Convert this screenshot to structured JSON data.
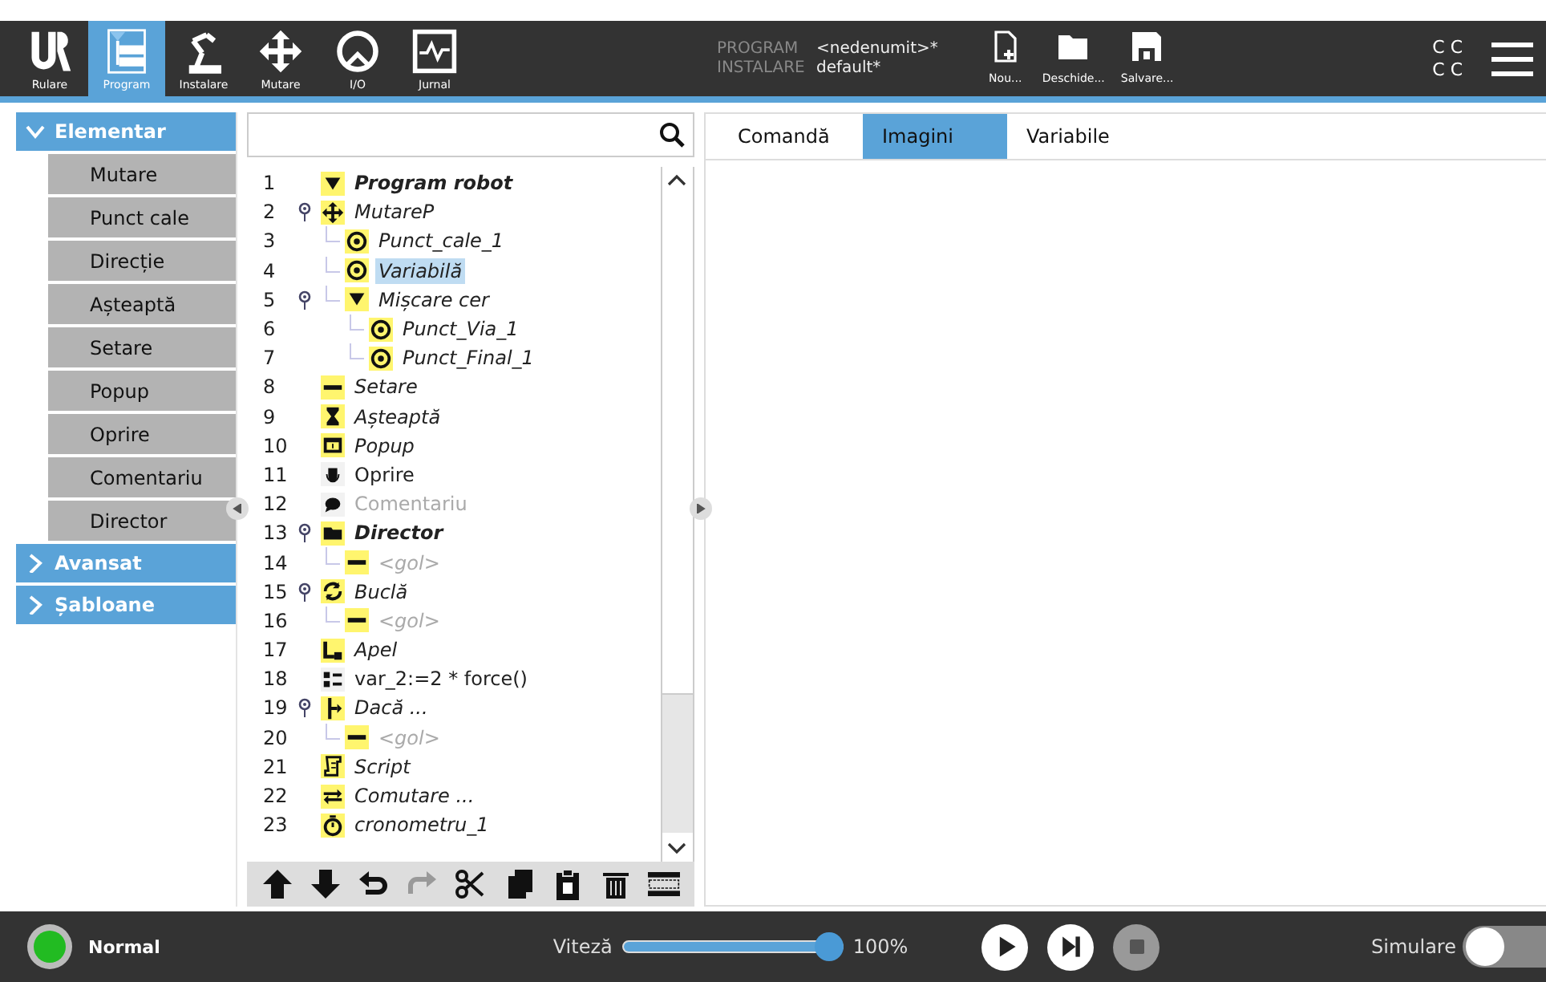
{
  "nav_tabs": [
    {
      "label": "Rulare",
      "kind": "logo",
      "selected": false
    },
    {
      "label": "Program",
      "kind": "program",
      "selected": true
    },
    {
      "label": "Instalare",
      "kind": "robot",
      "selected": false
    },
    {
      "label": "Mutare",
      "kind": "move",
      "selected": false
    },
    {
      "label": "I/O",
      "kind": "io",
      "selected": false
    },
    {
      "label": "Jurnal",
      "kind": "log",
      "selected": false
    }
  ],
  "file_info": [
    {
      "label": "PROGRAM",
      "value": "<nedenumit>*"
    },
    {
      "label": "INSTALARE",
      "value": "default*"
    }
  ],
  "file_buttons": [
    {
      "label": "Nou...",
      "kind": "new"
    },
    {
      "label": "Deschide...",
      "kind": "open"
    },
    {
      "label": "Salvare...",
      "kind": "save"
    }
  ],
  "indicator": [
    "C C",
    "C C"
  ],
  "sidebar": {
    "sections": [
      {
        "title": "Elementar",
        "expanded": true,
        "items": [
          "Mutare",
          "Punct cale",
          "Direcție",
          "Așteaptă",
          "Setare",
          "Popup",
          "Oprire",
          "Comentariu",
          "Director"
        ]
      },
      {
        "title": "Avansat",
        "expanded": false
      },
      {
        "title": "Șabloane",
        "expanded": false
      }
    ]
  },
  "tree": [
    {
      "line": "1",
      "label": "Program robot",
      "kind": "triangle",
      "bold": true,
      "italic": true,
      "disabled": false,
      "selected": false
    },
    {
      "line": "2",
      "label": "MutareP",
      "kind": "move",
      "bold": false,
      "italic": true,
      "disabled": false,
      "selected": false,
      "children": [
        {
          "line": "3",
          "label": "Punct_cale_1",
          "kind": "waypoint",
          "bold": false,
          "italic": true,
          "disabled": false,
          "selected": false
        },
        {
          "line": "4",
          "label": "Variabilă",
          "kind": "waypoint",
          "bold": false,
          "italic": true,
          "disabled": false,
          "selected": true
        },
        {
          "line": "5",
          "label": "Mișcare cer",
          "kind": "triangle",
          "bold": false,
          "italic": true,
          "disabled": false,
          "selected": false,
          "children": [
            {
              "line": "6",
              "label": "Punct_Via_1",
              "kind": "waypoint",
              "bold": false,
              "italic": true,
              "disabled": false,
              "selected": false
            },
            {
              "line": "7",
              "label": "Punct_Final_1",
              "kind": "waypoint",
              "bold": false,
              "italic": true,
              "disabled": false,
              "selected": false
            }
          ]
        }
      ]
    },
    {
      "line": "8",
      "label": "Setare",
      "kind": "set",
      "bold": false,
      "italic": true,
      "disabled": false,
      "selected": false
    },
    {
      "line": "9",
      "label": "Așteaptă",
      "kind": "wait",
      "bold": false,
      "italic": true,
      "disabled": false,
      "selected": false
    },
    {
      "line": "10",
      "label": "Popup",
      "kind": "popup",
      "bold": false,
      "italic": true,
      "disabled": false,
      "selected": false
    },
    {
      "line": "11",
      "label": "Oprire",
      "kind": "halt",
      "bold": false,
      "italic": false,
      "disabled": false,
      "selected": false
    },
    {
      "line": "12",
      "label": "Comentariu",
      "kind": "comment",
      "bold": false,
      "italic": false,
      "disabled": true,
      "selected": false
    },
    {
      "line": "13",
      "label": "Director",
      "kind": "folder",
      "bold": true,
      "italic": true,
      "disabled": false,
      "selected": false,
      "children": [
        {
          "line": "14",
          "label": "<gol>",
          "kind": "set",
          "bold": false,
          "italic": true,
          "disabled": true,
          "selected": false
        }
      ]
    },
    {
      "line": "15",
      "label": "Buclă",
      "kind": "loop",
      "bold": false,
      "italic": true,
      "disabled": false,
      "selected": false,
      "children": [
        {
          "line": "16",
          "label": "<gol>",
          "kind": "set",
          "bold": false,
          "italic": true,
          "disabled": true,
          "selected": false
        }
      ]
    },
    {
      "line": "17",
      "label": "Apel",
      "kind": "call",
      "bold": false,
      "italic": true,
      "disabled": false,
      "selected": false
    },
    {
      "line": "18",
      "label": "var_2:=2 * force()",
      "kind": "assign",
      "bold": false,
      "italic": false,
      "disabled": false,
      "selected": false
    },
    {
      "line": "19",
      "label": "Dacă ...",
      "kind": "if",
      "bold": false,
      "italic": true,
      "disabled": false,
      "selected": false,
      "children": [
        {
          "line": "20",
          "label": "<gol>",
          "kind": "set",
          "bold": false,
          "italic": true,
          "disabled": true,
          "selected": false
        }
      ]
    },
    {
      "line": "21",
      "label": "Script",
      "kind": "script",
      "bold": false,
      "italic": true,
      "disabled": false,
      "selected": false
    },
    {
      "line": "22",
      "label": "Comutare ...",
      "kind": "switch",
      "bold": false,
      "italic": true,
      "disabled": false,
      "selected": false
    },
    {
      "line": "23",
      "label": "cronometru_1",
      "kind": "timer",
      "bold": false,
      "italic": true,
      "disabled": false,
      "selected": false
    }
  ],
  "right_tabs": [
    {
      "label": "Comandă",
      "selected": false
    },
    {
      "label": "Imagini",
      "selected": true
    },
    {
      "label": "Variabile",
      "selected": false
    }
  ],
  "status_bar": {
    "status": "Normal",
    "speed_label": "Viteză",
    "speed": {
      "level": 1.0
    },
    "speed_reading": "100%",
    "stop_disabled": true,
    "simulation_label": "Simulare",
    "simulation_on": false
  }
}
